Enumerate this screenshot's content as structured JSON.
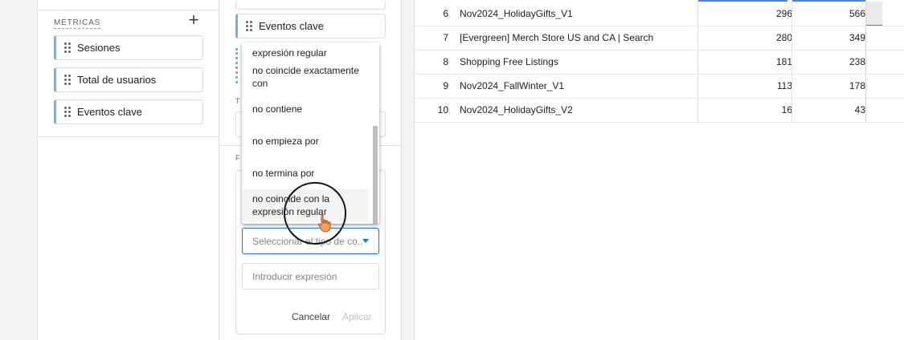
{
  "metrics": {
    "heading": "MÉTRICAS",
    "add_label": "+",
    "items": [
      {
        "label": "Sesiones"
      },
      {
        "label": "Total de usuarios"
      },
      {
        "label": "Eventos clave"
      }
    ]
  },
  "settings": {
    "values_chip": "Eventos clave",
    "tech_label_partial": "T",
    "filter_label_partial": "F"
  },
  "filter": {
    "condition_placeholder": "Seleccionar el tipo de co...",
    "expression_placeholder": "Introducir expresión",
    "cancel_label": "Cancelar",
    "apply_label": "Aplicar"
  },
  "dropdown": {
    "options": [
      "expresión regular",
      "no coincide exactamente con",
      "no contiene",
      "no empieza por",
      "no termina por",
      "no coincide con la expresión regular"
    ],
    "hovered_index": 5
  },
  "table": {
    "rows": [
      {
        "rank": "6",
        "name": "Nov2024_HolidayGifts_V1",
        "v1": "296",
        "v2": "566"
      },
      {
        "rank": "7",
        "name": "[Evergreen] Merch Store US and CA | Search",
        "v1": "280",
        "v2": "349"
      },
      {
        "rank": "8",
        "name": "Shopping Free Listings",
        "v1": "181",
        "v2": "238"
      },
      {
        "rank": "9",
        "name": "Nov2024_FallWinter_V1",
        "v1": "113",
        "v2": "178"
      },
      {
        "rank": "10",
        "name": "Nov2024_HolidayGifts_V2",
        "v1": "16",
        "v2": "43"
      }
    ]
  },
  "colors": {
    "accent_blue": "#1a73e8",
    "chip_left_border": "#7baaf7",
    "hover_bg": "#f1f3f4"
  },
  "icons": [
    "drag-handle-icon",
    "add-icon",
    "dropdown-caret-icon",
    "pointer-hand-icon"
  ]
}
